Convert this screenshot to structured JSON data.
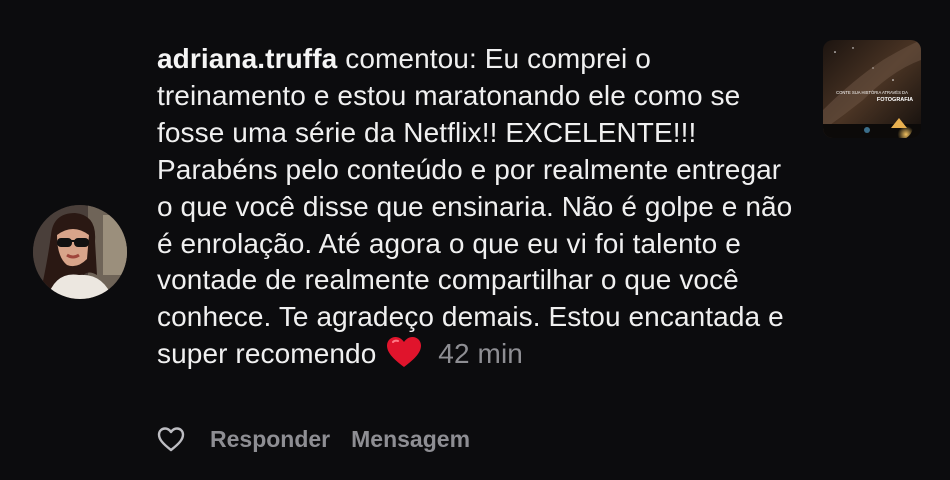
{
  "comment": {
    "username": "adriana.truffa",
    "verb": "comentou:",
    "text": "Eu comprei o treinamento e estou maratonando ele como se fosse uma série da Netflix!! EXCELENTE!!! Parabéns pelo conteúdo e por realmente entregar o que você disse que ensinaria. Não é golpe e não é enrolação. Até agora o que eu vi foi talento e vontade de realmente compartilhar o que você conhece. Te agradeço demais. Estou encantada e super recomendo",
    "emoji": "heart-emoji",
    "time": "42 min"
  },
  "post_thumbnail": {
    "caption_line1": "CONTE SUA HISTÓRIA ATRAVÉS DA",
    "caption_line2": "FOTOGRAFIA"
  },
  "actions": {
    "like_icon": "heart-outline-icon",
    "reply_label": "Responder",
    "message_label": "Mensagem"
  },
  "colors": {
    "background": "#0c0c0e",
    "text": "#f0f0f0",
    "muted": "#8e8e93",
    "heart": "#e0142c"
  }
}
